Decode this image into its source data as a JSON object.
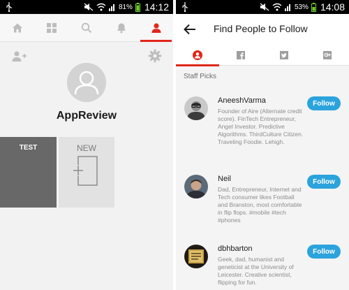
{
  "left_screen": {
    "status_bar": {
      "battery_percent": "81%",
      "time": "14:12"
    },
    "nav_tabs": [
      {
        "icon": "home-icon",
        "active": false
      },
      {
        "icon": "grid-icon",
        "active": false
      },
      {
        "icon": "search-icon",
        "active": false
      },
      {
        "icon": "bell-icon",
        "active": false
      },
      {
        "icon": "user-icon",
        "active": true
      }
    ],
    "profile": {
      "name": "AppReview"
    },
    "boards": [
      {
        "label": "TEST"
      },
      {
        "label": "NEW"
      }
    ]
  },
  "right_screen": {
    "status_bar": {
      "battery_percent": "53%",
      "time": "14:08"
    },
    "title": "Find People to Follow",
    "source_tabs": [
      {
        "icon": "user-icon",
        "active": true
      },
      {
        "icon": "facebook-icon",
        "active": false
      },
      {
        "icon": "twitter-icon",
        "active": false
      },
      {
        "icon": "google-plus-icon",
        "active": false
      }
    ],
    "section_title": "Staff Picks",
    "people": [
      {
        "name": "AneeshVarma",
        "bio": "Founder of Aire (Alternate credit score). FinTech Entrepreneur, Angel Investor. Predictive Algorithms. ThirdCulture Citizen. Traveling Foodie. Lehigh.",
        "follow_label": "Follow"
      },
      {
        "name": "Neil",
        "bio": "Dad, Entrepreneur, Internet and Tech consumer likes Football and Branston, most comfortable in flip flops. #mobile #tech #phones",
        "follow_label": "Follow"
      },
      {
        "name": "dbhbarton",
        "bio": "Geek, dad, humanist and geneticist at the University of Leicester. Creative scientist, flipping for fun.",
        "follow_label": "Follow"
      }
    ]
  },
  "colors": {
    "accent_red": "#e1271b",
    "follow_blue": "#2ba3dc",
    "status_bar": "#000000",
    "board_test": "#686868",
    "board_new": "#e2e2e2"
  }
}
